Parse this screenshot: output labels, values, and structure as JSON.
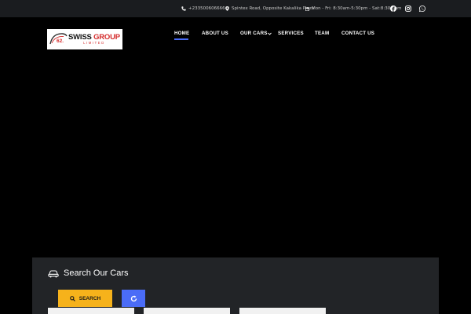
{
  "topbar": {
    "phone": "+233500606666",
    "address": "Spintex Road, Opposite Kakalika Plaza",
    "hours": "Mon - Fri: 8:30am-5:30pm - Sat:8:30-3pm",
    "social_icons": [
      "facebook-icon",
      "instagram-icon",
      "whatsapp-icon"
    ]
  },
  "logo": {
    "number": "62.",
    "swiss": "SWISS",
    "group": "GROUP",
    "limited": "LIMITED"
  },
  "nav": {
    "items": [
      {
        "label": "HOME",
        "active": true
      },
      {
        "label": "ABOUT US"
      },
      {
        "label": "OUR CARS",
        "has_dropdown": true
      },
      {
        "label": "SERVICES"
      },
      {
        "label": "TEAM"
      },
      {
        "label": "CONTACT US"
      }
    ],
    "dropdown_icon": "chevron-down-icon"
  },
  "search": {
    "title": "Search Our Cars",
    "title_icon": "car-icon",
    "search_label": "SEARCH",
    "search_icon": "search-icon",
    "reset_icon": "refresh-icon"
  },
  "colors": {
    "accent_blue": "#4a6cf7",
    "search_yellow": "#f6b21b",
    "logo_red": "#d42b2b",
    "panel_bg": "#222427",
    "topbar_bg": "#1a1c1f"
  }
}
